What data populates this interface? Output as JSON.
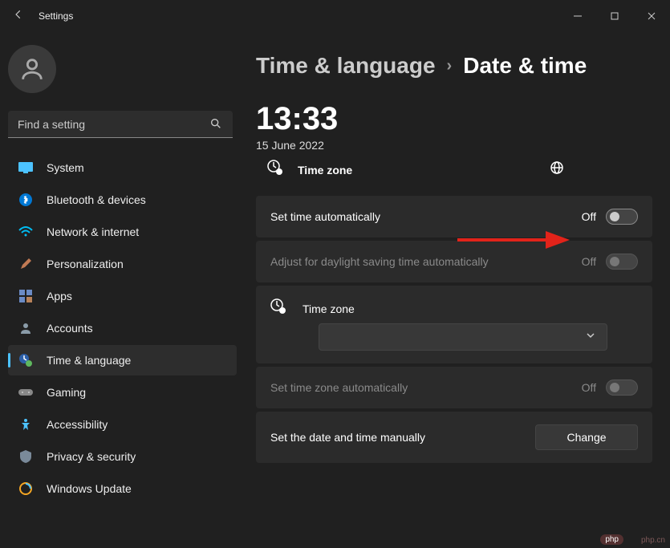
{
  "window": {
    "title": "Settings"
  },
  "search": {
    "placeholder": "Find a setting"
  },
  "nav": {
    "items": [
      {
        "label": "System"
      },
      {
        "label": "Bluetooth & devices"
      },
      {
        "label": "Network & internet"
      },
      {
        "label": "Personalization"
      },
      {
        "label": "Apps"
      },
      {
        "label": "Accounts"
      },
      {
        "label": "Time & language"
      },
      {
        "label": "Gaming"
      },
      {
        "label": "Accessibility"
      },
      {
        "label": "Privacy & security"
      },
      {
        "label": "Windows Update"
      }
    ]
  },
  "breadcrumb": {
    "parent": "Time & language",
    "current": "Date & time"
  },
  "clock": {
    "time": "13:33",
    "date": "15 June 2022"
  },
  "timezone_header": {
    "label": "Time zone"
  },
  "settings": {
    "auto_time": {
      "label": "Set time automatically",
      "state": "Off"
    },
    "dst": {
      "label": "Adjust for daylight saving time automatically",
      "state": "Off"
    },
    "timezone": {
      "label": "Time zone",
      "value": ""
    },
    "auto_tz": {
      "label": "Set time zone automatically",
      "state": "Off"
    },
    "manual": {
      "label": "Set the date and time manually",
      "button": "Change"
    }
  },
  "watermark": {
    "badge": "php",
    "text": "php.cn"
  }
}
